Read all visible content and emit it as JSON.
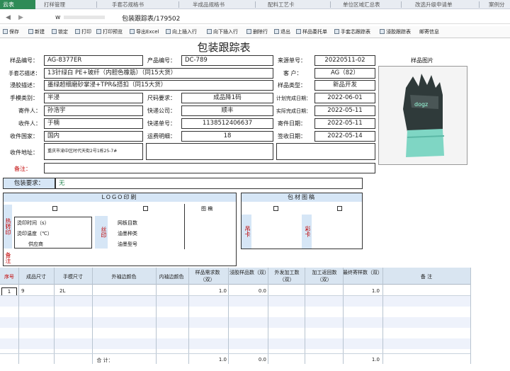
{
  "app": {
    "logo": "云表"
  },
  "tabs": [
    "打样管理",
    "手套芯规格书",
    "半成品规格书",
    "配料工艺卡",
    "单位区域汇总表",
    "改选升级申请单",
    "案例分"
  ],
  "title_bar": {
    "prefix": "w",
    "title": "包装跟踪表/179502"
  },
  "toolbar": [
    "保存",
    "新建",
    "锁定",
    "打印",
    "打印预览",
    "导出Excel",
    "向上插入行",
    "向下插入行",
    "删除行",
    "退出",
    "样品委托单",
    "手套芯跟踪表",
    "浸胶跟踪表",
    "邮寄信息"
  ],
  "form": {
    "title": "包装跟踪表",
    "labels": {
      "sample_no": "样品编号：",
      "product_no": "产品编号：",
      "source_no": "来源单号：",
      "sample_image": "样品图片",
      "glove_desc": "手套芯描述：",
      "customer": "客 户：",
      "dip_desc": "浸胶描述：",
      "sample_type": "样品类型：",
      "grip": "手模类别：",
      "size_req": "尺码要求：",
      "plan_date": "计划完成日期：",
      "sender": "寄件人：",
      "courier": "快递公司：",
      "actual_date": "实际完成日期：",
      "receiver": "收件人：",
      "tracking": "快递单号：",
      "send_date": "寄件日期：",
      "country": "收件国家：",
      "fee": "运费明细：",
      "sign_date": "签收日期：",
      "address": "收件地址：",
      "remark": "备注：",
      "pack_req": "包装要求："
    },
    "values": {
      "sample_no": "AG-8377ER",
      "product_no": "DC-789",
      "source_no": "20220511-02",
      "glove_desc": "13针绿白 PE+玻纤（内胆色橡筋）（同15大货）",
      "customer": "AG（82）",
      "dip_desc": "墨绿超细磨砂掌浸+TPR&搭扣（同15大货）",
      "sample_type": "新品开发",
      "grip": "半浸",
      "size_req": "成品降1码",
      "plan_date": "2022-06-01",
      "sender": "孙浩宇",
      "courier": "顺丰",
      "actual_date": "2022-05-11",
      "receiver": "于楠",
      "tracking": "1138512406637",
      "send_date": "2022-05-11",
      "country": "国内",
      "fee": "18",
      "sign_date": "2022-05-14",
      "address": "重庆市渝中区时代天街2号1栋25-7#",
      "pack_req": "无"
    }
  },
  "logo_print": {
    "title": "LOGO印刷",
    "hot_label": "热转印",
    "silk_label": "丝印",
    "pattern": "图 稿",
    "rows": [
      "烫印时间（s）",
      "烫印温度（℃）",
      "供应商"
    ],
    "silk_rows": [
      "网板目数",
      "油墨种类",
      "油墨型号"
    ],
    "side_note": "备注"
  },
  "pack_material": {
    "title": "包材图稿",
    "hang": "吊卡",
    "color_card": "彩卡"
  },
  "grid": {
    "headers": [
      "序号",
      "成品尺寸",
      "手模尺寸",
      "外袖边颜色",
      "内袖边颜色",
      "样品需求数（双）",
      "浸胶样品数（双）",
      "外发加工数（双）",
      "加工返回数（双）",
      "最终寄样数（双）",
      "备 注"
    ],
    "row1": [
      "1",
      "9",
      "2L",
      "",
      "",
      "1.0",
      "0.0",
      "",
      "",
      "1.0",
      ""
    ],
    "total_label": "合 计：",
    "totals": [
      "1.0",
      "0.0",
      "",
      "",
      "1.0"
    ]
  }
}
